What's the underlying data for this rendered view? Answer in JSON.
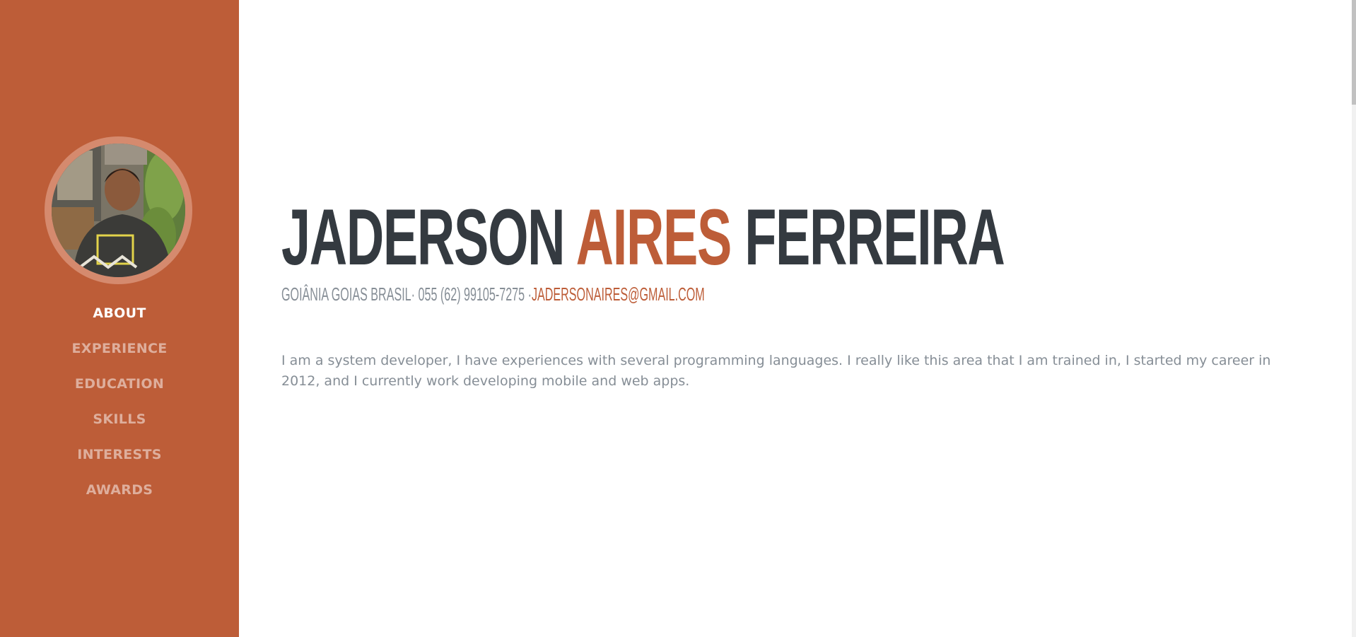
{
  "sidebar": {
    "accent_color": "#bd5d38",
    "profile_image_alt": "profile photo",
    "nav": [
      {
        "label": "ABOUT",
        "active": true
      },
      {
        "label": "EXPERIENCE",
        "active": false
      },
      {
        "label": "EDUCATION",
        "active": false
      },
      {
        "label": "SKILLS",
        "active": false
      },
      {
        "label": "INTERESTS",
        "active": false
      },
      {
        "label": "AWARDS",
        "active": false
      }
    ]
  },
  "about": {
    "name_first": "JADERSON",
    "name_middle": "AIRES",
    "name_last": "FERREIRA",
    "location": "GOIÂNIA GOIAS BRASIL",
    "phone": "055 (62) 99105-7275",
    "separator": "·",
    "email": "JADERSONAIRES@GMAIL.COM",
    "lead": "I am a system developer, I have experiences with several programming languages. I really like this area that I am trained in, I started my career in 2012, and I currently work developing mobile and web apps."
  },
  "colors": {
    "heading": "#343a40",
    "muted": "#868e96",
    "accent": "#bd5d38"
  }
}
